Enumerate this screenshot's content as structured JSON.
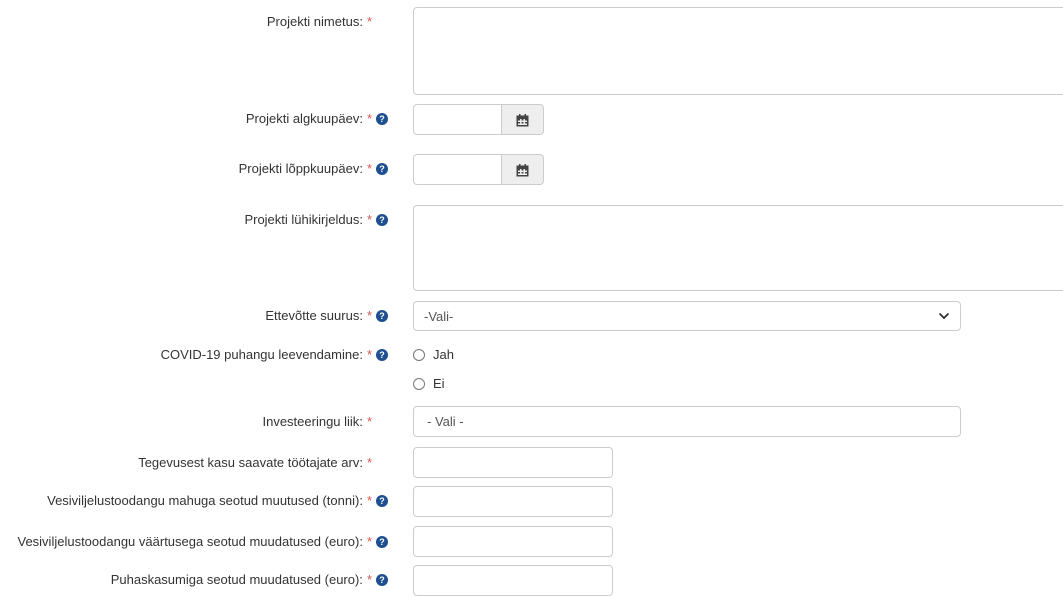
{
  "form": {
    "required_mark": "*",
    "help_glyph": "?",
    "project_name": {
      "label": "Projekti nimetus:",
      "value": ""
    },
    "start_date": {
      "label": "Projekti algkuupäev:",
      "value": ""
    },
    "end_date": {
      "label": "Projekti lõppkuupäev:",
      "value": ""
    },
    "short_description": {
      "label": "Projekti lühikirjeldus:",
      "value": ""
    },
    "company_size": {
      "label": "Ettevõtte suurus:",
      "selected": "-Vali-"
    },
    "covid": {
      "label": "COVID-19 puhangu leevendamine:",
      "options": [
        {
          "label": "Jah",
          "checked": false
        },
        {
          "label": "Ei",
          "checked": false
        }
      ]
    },
    "investment_type": {
      "label": "Investeeringu liik:",
      "selected": "- Vali -"
    },
    "employees": {
      "label": "Tegevusest kasu saavate töötajate arv:",
      "value": ""
    },
    "aquaculture_volume": {
      "label": "Vesiviljelustoodangu mahuga seotud muutused (tonni):",
      "value": ""
    },
    "aquaculture_value": {
      "label": "Vesiviljelustoodangu väärtusega seotud muudatused (euro):",
      "value": ""
    },
    "net_profit": {
      "label": "Puhaskasumiga seotud muudatused  (euro):",
      "value": ""
    }
  },
  "colors": {
    "required": "#d9534f",
    "help_icon": "#1d4f91",
    "border": "#cccccc",
    "addon_bg": "#eeeeee"
  },
  "icons": {
    "date_button": "calendar-icon",
    "help": "question-circle-icon",
    "select": "chevron-down-icon"
  }
}
